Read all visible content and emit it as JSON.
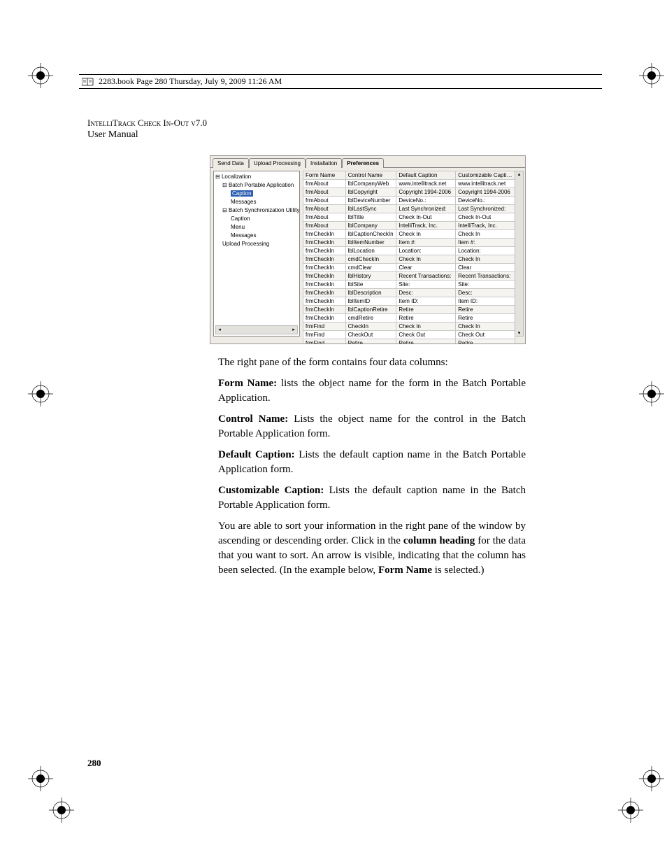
{
  "header_bar": "2283.book  Page 280  Thursday, July 9, 2009  11:26 AM",
  "running_head1": "IntelliTrack Check In-Out v7.0",
  "running_head2": "User Manual",
  "tabs": {
    "t0": "Send Data",
    "t1": "Upload Processing",
    "t2": "Installation",
    "t3": "Preferences"
  },
  "tree": {
    "n0": "Localization",
    "n1": "Batch Portable Application",
    "n2": "Caption",
    "n3": "Messages",
    "n4": "Batch Synchronization Utility",
    "n5": "Caption",
    "n6": "Menu",
    "n7": "Messages",
    "n8": "Upload Processing"
  },
  "grid": {
    "h0": "Form Name",
    "h1": "Control Name",
    "h2": "Default Caption",
    "h3": "Customizable Caption",
    "rows": [
      [
        "frmAbout",
        "lblCompanyWeb",
        "www.intellitrack.net",
        "www.intellitrack.net"
      ],
      [
        "frmAbout",
        "lblCopyright",
        "Copyright 1994-2006",
        "Copyright 1994-2006"
      ],
      [
        "frmAbout",
        "lblDeviceNumber",
        "DeviceNo.:",
        "DeviceNo.:"
      ],
      [
        "frmAbout",
        "lblLastSync",
        "Last Synchronized:",
        "Last Synchronized:"
      ],
      [
        "frmAbout",
        "lblTitle",
        "Check In-Out",
        "Check In-Out"
      ],
      [
        "frmAbout",
        "lblCompany",
        "IntelliTrack, Inc.",
        "IntelliTrack, Inc."
      ],
      [
        "frmCheckIn",
        "lblCaptionCheckIn",
        "Check In",
        "Check In"
      ],
      [
        "frmCheckIn",
        "lblItemNumber",
        "Item #:",
        "Item #:"
      ],
      [
        "frmCheckIn",
        "lblLocation",
        "Location:",
        "Location:"
      ],
      [
        "frmCheckIn",
        "cmdCheckIn",
        "Check In",
        "Check In"
      ],
      [
        "frmCheckIn",
        "cmdClear",
        "Clear",
        "Clear"
      ],
      [
        "frmCheckIn",
        "lblHistory",
        "Recent Transactions:",
        "Recent Transactions:"
      ],
      [
        "frmCheckIn",
        "lblSite",
        "Site:",
        "Site:"
      ],
      [
        "frmCheckIn",
        "lblDescription",
        "Desc:",
        "Desc:"
      ],
      [
        "frmCheckIn",
        "lblItemID",
        "Item ID:",
        "Item ID:"
      ],
      [
        "frmCheckIn",
        "lblCaptionRetire",
        "Retire",
        "Retire"
      ],
      [
        "frmCheckIn",
        "cmdRetire",
        "Retire",
        "Retire"
      ],
      [
        "frmFind",
        "CheckIn",
        "Check In",
        "Check In"
      ],
      [
        "frmFind",
        "CheckOut",
        "Check Out",
        "Check Out"
      ],
      [
        "frmFind",
        "Retire",
        "Retire",
        "Retire"
      ]
    ]
  },
  "body": {
    "p1": "The right pane of the form contains four data columns:",
    "p2a": "Form Name:",
    "p2b": " lists the object name for the form in the Batch Portable Application.",
    "p3a": "Control Name:",
    "p3b": " Lists the object name for the control in the Batch Portable Application form.",
    "p4a": "Default Caption:",
    "p4b": " Lists the default caption name in the Batch Portable Application form.",
    "p5a": "Customizable Caption:",
    "p5b": " Lists the default caption name in the Batch Portable Application form.",
    "p6a": "You are able to sort your information in the right pane of the window by ascending or descending order. Click in the ",
    "p6b": "column heading",
    "p6c": " for the data that you want to sort. An arrow is visible, indicating that the column has been selected. (In the example below, ",
    "p6d": "Form Name",
    "p6e": " is selected.)"
  },
  "page_number": "280"
}
